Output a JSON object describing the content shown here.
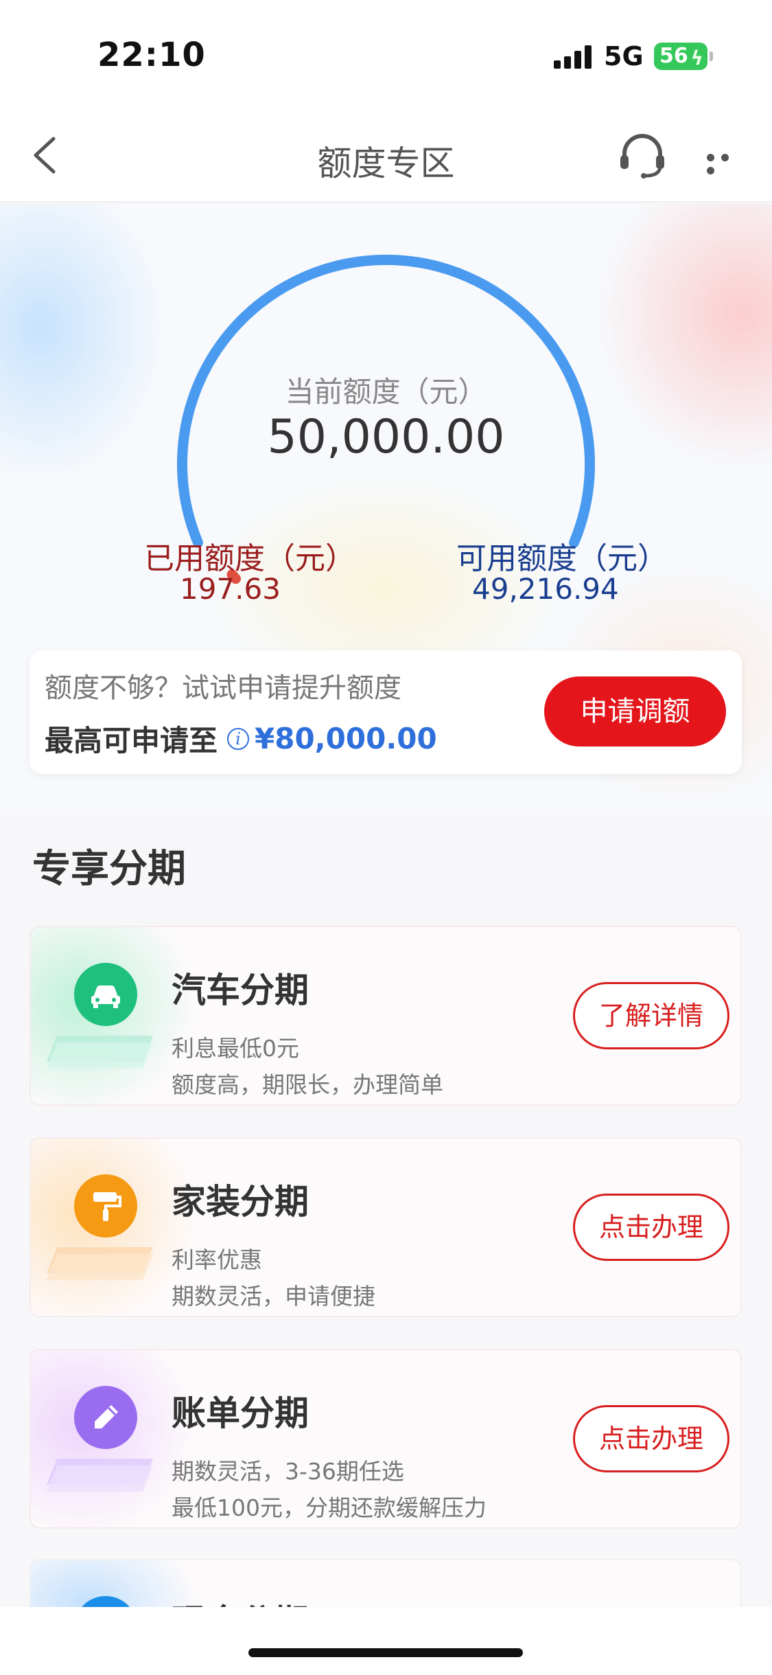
{
  "status_bar": {
    "time": "22:10",
    "network": "5G",
    "battery": "56"
  },
  "nav": {
    "title": "额度专区"
  },
  "credit": {
    "current_label": "当前额度（元）",
    "current_value": "50,000.00",
    "used_label": "已用额度（元）",
    "used_value": "197.63",
    "available_label": "可用额度（元）",
    "available_value": "49,216.94",
    "used_fraction": 0.004
  },
  "raise": {
    "hint": "额度不够？试试申请提升额度",
    "max_label": "最高可申请至",
    "max_amount": "¥80,000.00",
    "button": "申请调额"
  },
  "section": {
    "title": "专享分期"
  },
  "cards": [
    {
      "title": "汽车分期",
      "line1": "利息最低0元",
      "line2": "额度高，期限长，办理简单",
      "button": "了解详情",
      "icon": "car-icon",
      "color": "#1fbf7e"
    },
    {
      "title": "家装分期",
      "line1": "利率优惠",
      "line2": "期数灵活，申请便捷",
      "button": "点击办理",
      "icon": "paint-roller-icon",
      "color": "#f59a12"
    },
    {
      "title": "账单分期",
      "line1": "期数灵活，3-36期任选",
      "line2": "最低100元，分期还款缓解压力",
      "button": "点击办理",
      "icon": "pencil-icon",
      "color": "#9a6cf0"
    },
    {
      "title": "现金分期",
      "icon": "cash-icon",
      "color": "#1a8ee8"
    }
  ],
  "colors": {
    "primary_red": "#e4161b",
    "arc_blue": "#4a9af0",
    "used_red": "#9b1d1d",
    "available_blue": "#1a3e8f"
  }
}
